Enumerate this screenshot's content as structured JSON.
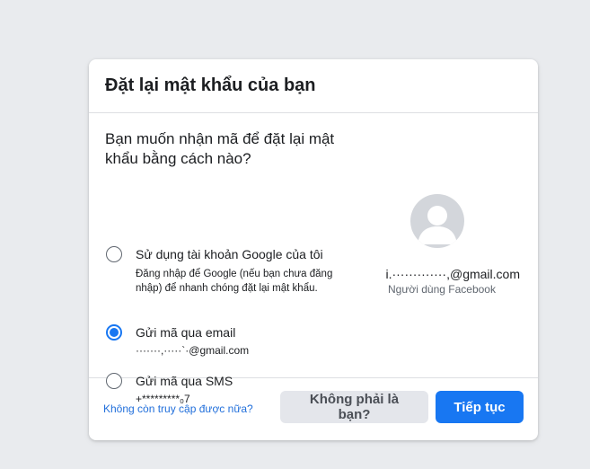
{
  "dialog": {
    "title": "Đặt lại mật khẩu của bạn",
    "question": "Bạn muốn nhận mã để đặt lại mật khẩu bằng cách nào?"
  },
  "options": [
    {
      "label": "Sử dụng tài khoản Google của tôi",
      "sub": "Đăng nhập để Google (nếu bạn chưa đăng nhập) để nhanh chóng đặt lại mật khẩu.",
      "selected": false
    },
    {
      "label": "Gửi mã qua email",
      "sub": "·······,·····`·@gmail.com",
      "selected": true
    },
    {
      "label": "Gửi mã qua SMS",
      "sub": "+*********₀7",
      "selected": false
    }
  ],
  "profile": {
    "email": "i.·············,@gmail.com",
    "role": "Người dùng Facebook",
    "avatar_icon": "default-avatar-icon"
  },
  "footer": {
    "lost_access_link": "Không còn truy cập được nữa?",
    "not_you_button": "Không phải là bạn?",
    "continue_button": "Tiếp tục"
  },
  "colors": {
    "accent": "#1877f2",
    "link": "#216fdb",
    "page_bg": "#e9ebee",
    "secondary_button_bg": "#e4e6eb"
  }
}
